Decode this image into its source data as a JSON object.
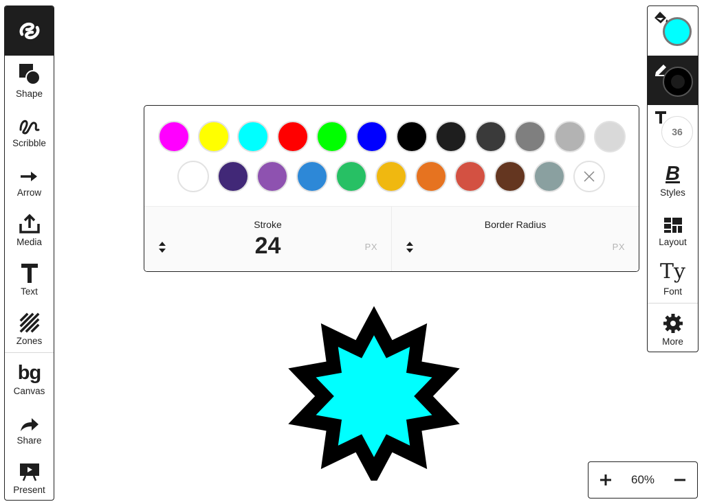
{
  "left_toolbar": {
    "tools": [
      {
        "label": "Shape"
      },
      {
        "label": "Scribble"
      },
      {
        "label": "Arrow"
      },
      {
        "label": "Media"
      },
      {
        "label": "Text"
      },
      {
        "label": "Zones"
      },
      {
        "label": "Canvas",
        "glyph": "bg"
      },
      {
        "label": "Share"
      },
      {
        "label": "Present"
      }
    ]
  },
  "right_toolbar": {
    "fill_color": "#00ffff",
    "stroke_color": "#000000",
    "font_size_badge": "36",
    "tools": [
      {
        "label": "Styles",
        "glyph": "B"
      },
      {
        "label": "Layout"
      },
      {
        "label": "Font",
        "glyph": "Ty"
      },
      {
        "label": "More"
      }
    ]
  },
  "color_picker": {
    "row1": [
      "#ff00ff",
      "#ffff00",
      "#00ffff",
      "#ff0000",
      "#00ff00",
      "#0000ff",
      "#000000",
      "#1e1e1e",
      "#3a3a3a",
      "#7f7f7f",
      "#b3b3b3",
      "#d9d9d9"
    ],
    "row2": [
      "#ffffff",
      "#412877",
      "#8e52b0",
      "#2d88d7",
      "#27c064",
      "#f0b810",
      "#e67320",
      "#d35142",
      "#643620",
      "#8aa0a0"
    ],
    "stroke": {
      "title": "Stroke",
      "value": "24",
      "unit": "PX"
    },
    "border_radius": {
      "title": "Border Radius",
      "value": "",
      "unit": "PX"
    }
  },
  "canvas": {
    "star": {
      "fill": "#00ffff",
      "stroke": "#000000",
      "points": 10
    }
  },
  "zoom": {
    "level": "60%"
  }
}
